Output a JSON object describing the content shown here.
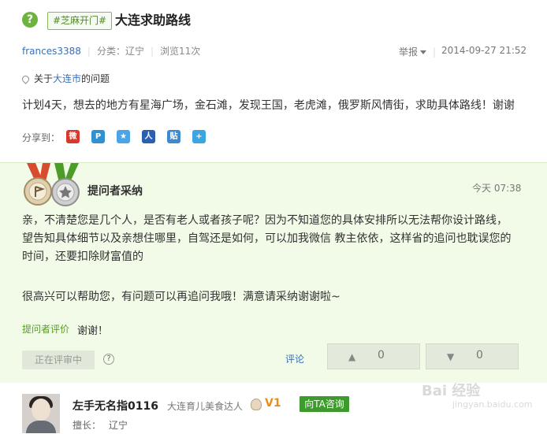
{
  "question": {
    "tag": "#芝麻开门#",
    "title": "大连求助路线",
    "user": "frances3388",
    "category_label": "分类：",
    "category": "辽宁",
    "views_label": "浏览",
    "views": "11次",
    "report": "举报",
    "time": "2014-09-27 21:52",
    "about_prefix": "关于",
    "about_city": "大连市",
    "about_suffix": "的问题",
    "body": "计划4天，想去的地方有星海广场，金石滩，发现王国，老虎滩，俄罗斯风情街，求助具体路线！谢谢",
    "share_label": "分享到："
  },
  "answer": {
    "accepted_label": "提问者采纳",
    "time": "今天 07:38",
    "lines": [
      "亲，不清楚您是几个人，是否有老人或者孩子呢？因为不知道您的具体安排所以无法帮你设计路线，",
      "望告知具体细节以及亲想住哪里，自驾还是如何，可以加我微信 教主依依，这样省的追问也耽误您的",
      "时间，还要扣除财富值的",
      "很高兴可以帮助您，有问题可以再追问我哦！满意请采纳谢谢啦~"
    ],
    "eval_label": "提问者评价",
    "eval_text": "谢谢！",
    "review_button": "正在评审中",
    "comment": "评论",
    "upvotes": "0",
    "downvotes": "0"
  },
  "answerer": {
    "name": "左手无名指0116",
    "title": "大连育儿美食达人",
    "level": "V1",
    "consult_button": "向TA咨询",
    "specialty_label": "擅长：",
    "specialty": "辽宁"
  },
  "watermark": {
    "main": "Bai 经验",
    "sub": "jingyan.baidu.com"
  }
}
